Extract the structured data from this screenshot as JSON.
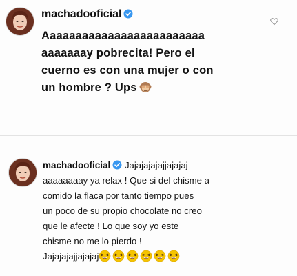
{
  "comments": [
    {
      "username": "machadooficial",
      "verified": true,
      "text_lines": [
        "Aaaaaaaaaaaaaaaaaaaaaaaaa",
        "aaaaaaay pobrecita! Pero el",
        "cuerno es con una mujer o con",
        "un hombre ? Ups"
      ],
      "trailing_emoji": "see-no-evil-monkey-icon",
      "like_icon": "heart-outline-icon"
    },
    {
      "username": "machadooficial",
      "verified": true,
      "first_line_text": "Jajajajajajjajajaj",
      "text_lines": [
        "aaaaaaaay ya relax ! Que si del chisme a",
        "comido la flaca por tanto tiempo  pues",
        "un poco de su propio chocolate no creo",
        "que le afecte ! Lo que soy yo este",
        "chisme no me lo pierdo !"
      ],
      "last_line_text": "Jajajajajjajajaj",
      "trailing_emoji": "grinning-squinting-face-icon",
      "trailing_emoji_count": 6
    }
  ],
  "colors": {
    "verified_badge": "#3897f0",
    "emoji_yellow": "#f5c400",
    "background": "#fdfdfd",
    "text": "#111111"
  }
}
